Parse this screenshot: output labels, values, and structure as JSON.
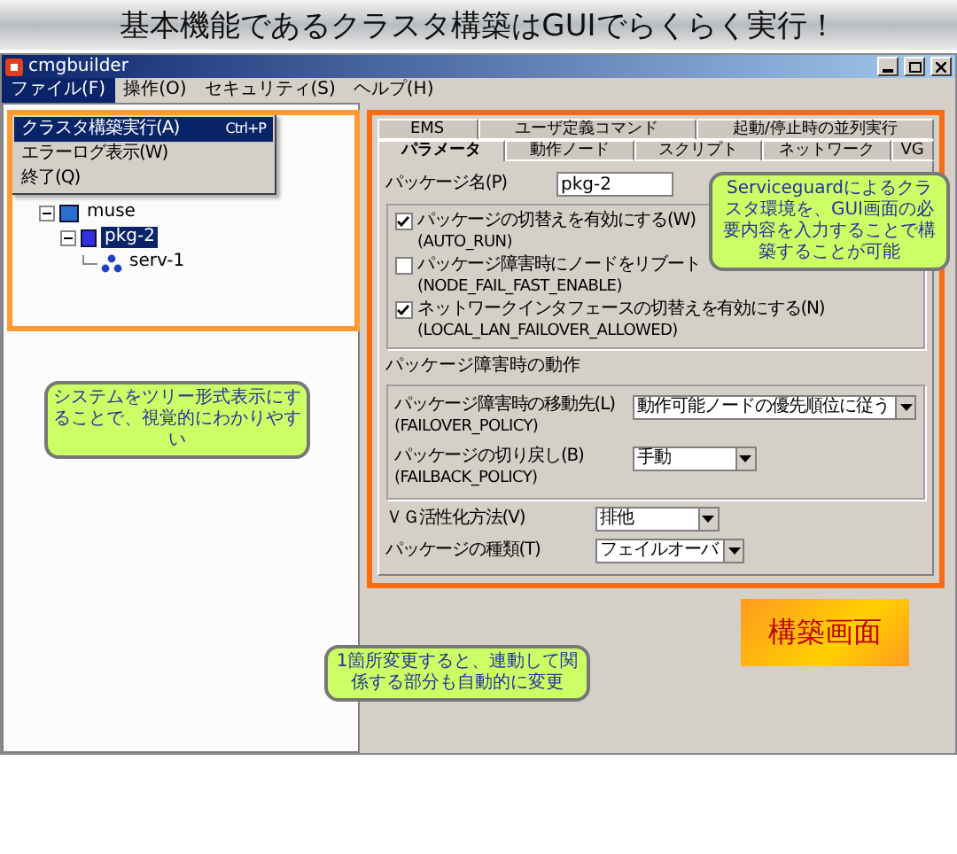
{
  "banner": {
    "title": "基本機能であるクラスタ構築はGUIでらくらく実行！"
  },
  "window": {
    "title": "cmgbuilder"
  },
  "menu": [
    {
      "label": "ファイル(F)",
      "selected": true
    },
    {
      "label": "操作(O)",
      "selected": false
    },
    {
      "label": "セキュリティ(S)",
      "selected": false
    },
    {
      "label": "ヘルプ(H)",
      "selected": false
    }
  ],
  "file_menu": [
    {
      "label": "クラスタ構築実行(A)",
      "shortcut": "Ctrl+P",
      "selected": true
    },
    {
      "label": "エラーログ表示(W)",
      "selected": false
    },
    {
      "label": "終了(Q)",
      "selected": false
    }
  ],
  "tree": [
    {
      "label": "muse",
      "kind": "cluster",
      "selected": false,
      "children": [
        {
          "label": "pkg-2",
          "kind": "package",
          "selected": true,
          "children": [
            {
              "label": "serv-1",
              "kind": "node",
              "selected": false
            }
          ]
        }
      ]
    }
  ],
  "tabs_back": [
    {
      "label": "EMS",
      "selected": false
    },
    {
      "label": "ユーザ定義コマンド",
      "selected": false
    },
    {
      "label": "起動/停止時の並列実行",
      "selected": false
    }
  ],
  "tabs_front": [
    {
      "label": "パラメータ",
      "selected": true
    },
    {
      "label": "動作ノード",
      "selected": false
    },
    {
      "label": "スクリプト",
      "selected": false
    },
    {
      "label": "ネットワーク",
      "selected": false
    },
    {
      "label": "VG",
      "selected": false
    }
  ],
  "package_name": {
    "label": "パッケージ名(P)",
    "value": "pkg-2"
  },
  "options": [
    {
      "label": "パッケージの切替えを有効にする(W)",
      "param": "(AUTO_RUN)",
      "checked": true
    },
    {
      "label": "パッケージ障害時にノードをリブート",
      "param": "(NODE_FAIL_FAST_ENABLE)",
      "checked": false
    },
    {
      "label": "ネットワークインタフェースの切替えを有効にする(N)",
      "param": "(LOCAL_LAN_FAILOVER_ALLOWED)",
      "checked": true
    }
  ],
  "failure_group": {
    "title": "パッケージ障害時の動作",
    "fields": [
      {
        "label": "パッケージ障害時の移動先(L)",
        "param": "(FAILOVER_POLICY)",
        "value": "動作可能ノードの優先順位に従う"
      },
      {
        "label": "パッケージの切り戻し(B)",
        "param": "(FAILBACK_POLICY)",
        "value": "手動"
      }
    ]
  },
  "fields": [
    {
      "label": "ＶＧ活性化方法(V)",
      "value": "排他"
    },
    {
      "label": "パッケージの種類(T)",
      "value": "フェイルオーバ"
    }
  ],
  "callouts": [
    {
      "kind": "tree",
      "text": "システムをツリー形式表示にすることで、視覚的にわかりやすい"
    },
    {
      "kind": "form",
      "text": "Serviceguardによるクラスタ環境を、GUI画面の必要内容を入力することで構築することが可能"
    },
    {
      "kind": "link",
      "text": "1箇所変更すると、連動して関係する部分も自動的に変更"
    }
  ],
  "badge": {
    "text": "構築画面"
  }
}
